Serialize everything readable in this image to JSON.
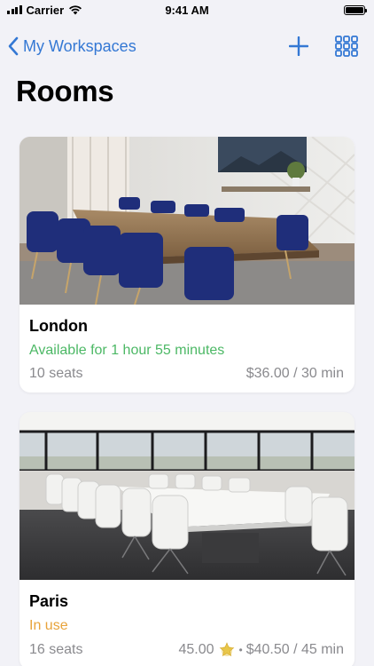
{
  "status_bar": {
    "carrier": "Carrier",
    "time": "9:41 AM"
  },
  "nav": {
    "back_label": "My Workspaces",
    "back_icon": "chevron-left-icon",
    "add_icon": "plus-icon",
    "grid_icon": "grid-icon",
    "accent": "#3478d4"
  },
  "page": {
    "title": "Rooms"
  },
  "rooms": [
    {
      "name": "London",
      "status": "Available for 1 hour 55 minutes",
      "status_color": "#4cb865",
      "seats": "10 seats",
      "price": "$36.00 / 30 min"
    },
    {
      "name": "Paris",
      "status": "In use",
      "status_color": "#e8a33a",
      "seats": "16 seats",
      "rating": "45.00",
      "rating_icon": "star-badge-icon",
      "separator": "•",
      "price": "$40.50 / 45 min"
    }
  ]
}
